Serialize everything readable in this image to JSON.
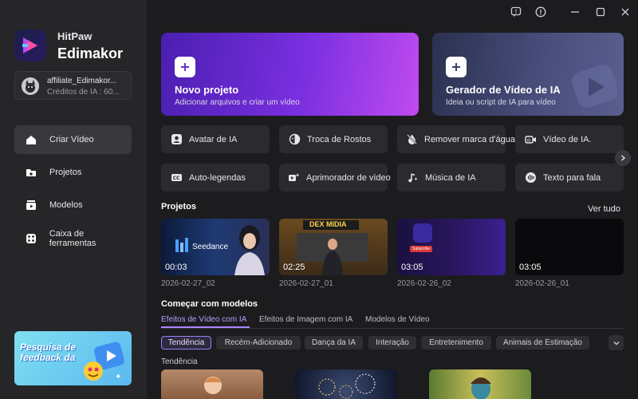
{
  "brand": {
    "line1": "HitPaw",
    "line2": "Edimakor"
  },
  "user": {
    "name": "affiliate_Edimakor...",
    "credits": "Créditos de IA : 60..."
  },
  "nav": [
    {
      "label": "Criar Vídeo",
      "icon": "home-icon",
      "active": true
    },
    {
      "label": "Projetos",
      "icon": "folder-icon",
      "active": false
    },
    {
      "label": "Modelos",
      "icon": "templates-icon",
      "active": false
    },
    {
      "label": "Caixa de ferramentas",
      "icon": "toolbox-icon",
      "active": false
    }
  ],
  "feedback": {
    "text": "Pesquisa de feedback da"
  },
  "cards": {
    "new_project": {
      "title": "Novo projeto",
      "subtitle": "Adicionar arquivos e criar um vídeo"
    },
    "generator": {
      "title": "Gerador de Vídeo de IA",
      "subtitle": "Ideia ou script de IA para vídeo"
    }
  },
  "tools": [
    {
      "label": "Avatar de IA",
      "icon": "avatar-icon"
    },
    {
      "label": "Troca de Rostos",
      "icon": "face-swap-icon"
    },
    {
      "label": "Remover marca d'água",
      "icon": "watermark-remove-icon"
    },
    {
      "label": "Vídeo de IA.",
      "icon": "ai-video-icon"
    },
    {
      "label": "Auto-legendas",
      "icon": "captions-icon"
    },
    {
      "label": "Aprimorador de vídeo",
      "icon": "video-enhancer-icon"
    },
    {
      "label": "Música de IA",
      "icon": "music-icon"
    },
    {
      "label": "Texto para fala",
      "icon": "text-to-speech-icon"
    }
  ],
  "projects": {
    "title": "Projetos",
    "see_all": "Ver tudo",
    "items": [
      {
        "duration": "00:03",
        "date": "2026-02-27_02",
        "thumb_text": "Seedance"
      },
      {
        "duration": "02:25",
        "date": "2026-02-27_01",
        "thumb_text": "DEX MIDIA"
      },
      {
        "duration": "03:05",
        "date": "2026-02-26_02",
        "thumb_text": "Subscribe"
      },
      {
        "duration": "03:05",
        "date": "2026-02-26_01",
        "thumb_text": ""
      }
    ]
  },
  "templates": {
    "title": "Começar com modelos",
    "tabs": [
      "Efeitos de Vídeo com IA",
      "Efeitos de Imagem com IA",
      "Modelos de Vídeo"
    ],
    "chips": [
      "Tendência",
      "Recém-Adicionado",
      "Dança da IA",
      "Interação",
      "Entretenimento",
      "Animais de Estimação"
    ],
    "subsection": "Tendência"
  },
  "colors": {
    "accent": "#9a7cff",
    "sidebar": "#262629",
    "background": "#1c1c1f"
  }
}
